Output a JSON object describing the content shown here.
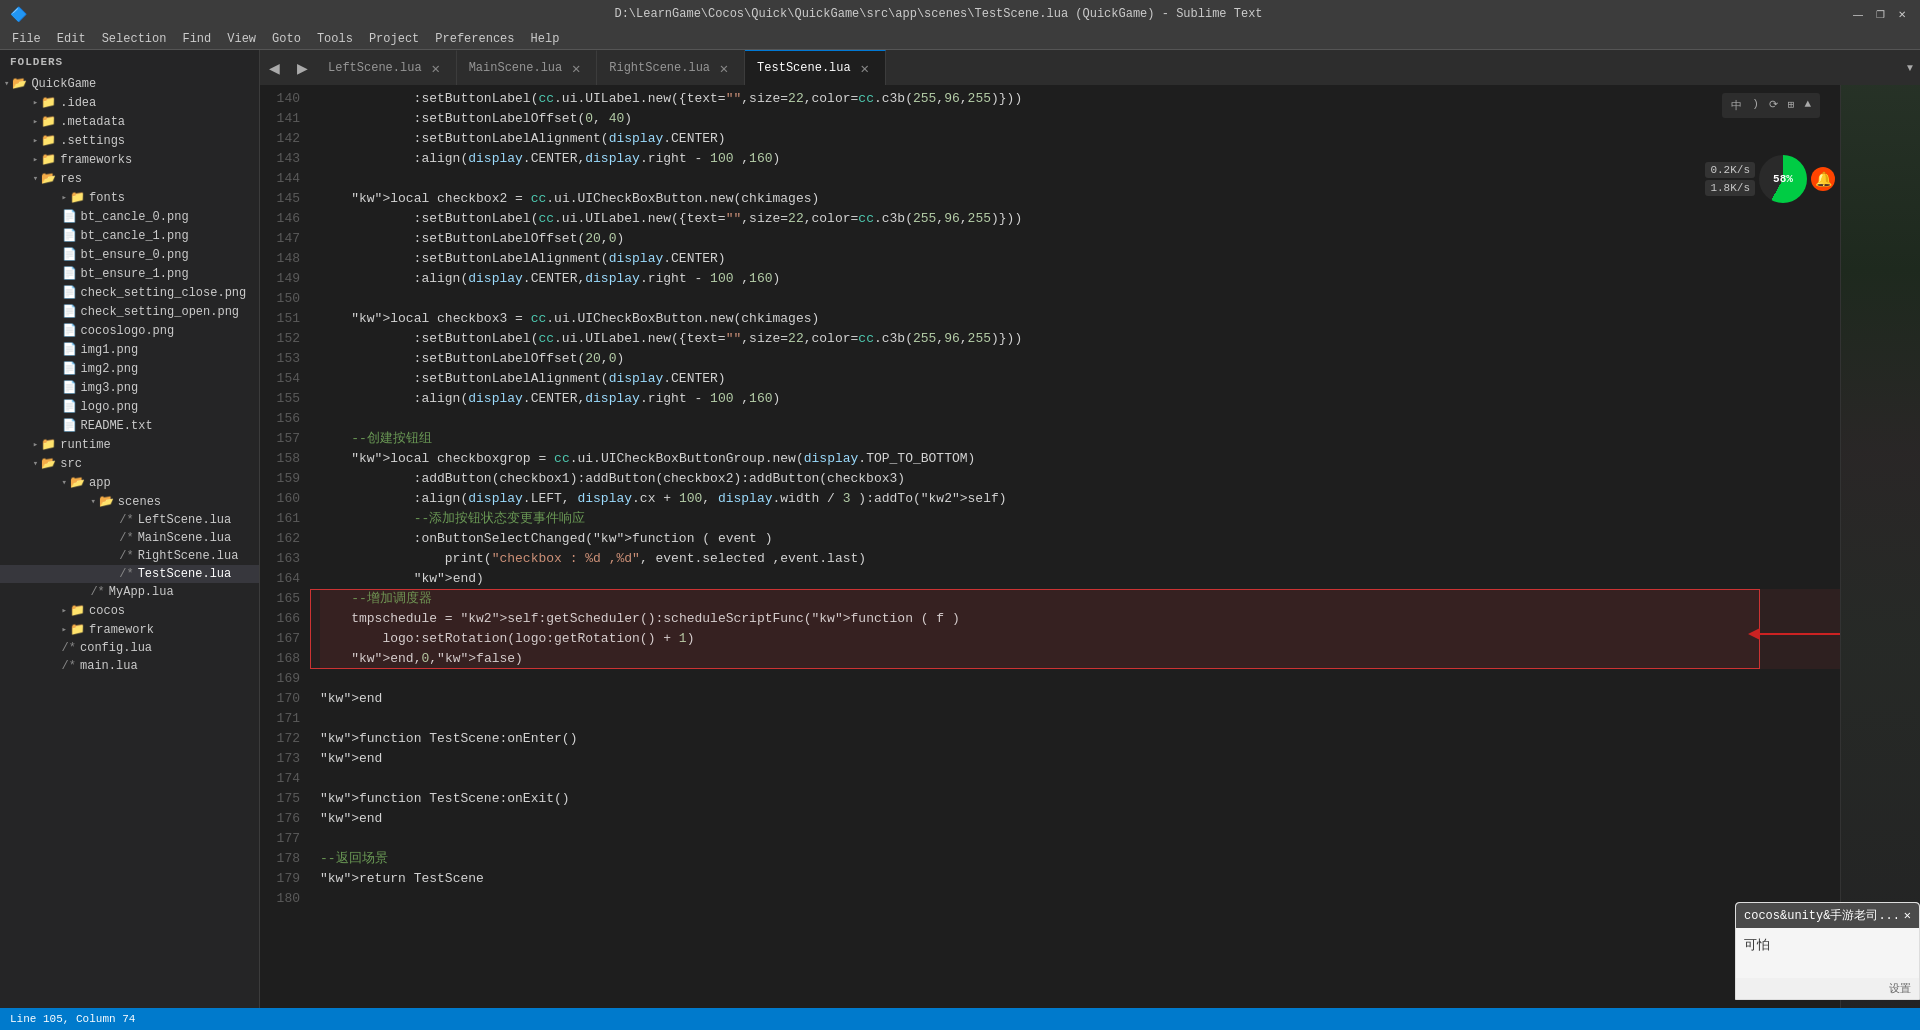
{
  "titleBar": {
    "title": "D:\\LearnGame\\Cocos\\Quick\\QuickGame\\src\\app\\scenes\\TestScene.lua (QuickGame) - Sublime Text",
    "minimize": "—",
    "maximize": "❐",
    "close": "✕"
  },
  "menuBar": {
    "items": [
      "File",
      "Edit",
      "Selection",
      "Find",
      "View",
      "Goto",
      "Tools",
      "Project",
      "Preferences",
      "Help"
    ]
  },
  "sidebar": {
    "header": "FOLDERS",
    "tree": [
      {
        "level": 0,
        "type": "folder",
        "open": true,
        "label": "QuickGame"
      },
      {
        "level": 1,
        "type": "folder",
        "open": false,
        "label": ".idea"
      },
      {
        "level": 1,
        "type": "folder",
        "open": false,
        "label": ".metadata"
      },
      {
        "level": 1,
        "type": "folder",
        "open": false,
        "label": ".settings"
      },
      {
        "level": 1,
        "type": "folder",
        "open": false,
        "label": "frameworks"
      },
      {
        "level": 1,
        "type": "folder",
        "open": true,
        "label": "res"
      },
      {
        "level": 2,
        "type": "folder",
        "open": false,
        "label": "fonts"
      },
      {
        "level": 2,
        "type": "file",
        "label": "bt_cancle_0.png"
      },
      {
        "level": 2,
        "type": "file",
        "label": "bt_cancle_1.png"
      },
      {
        "level": 2,
        "type": "file",
        "label": "bt_ensure_0.png"
      },
      {
        "level": 2,
        "type": "file",
        "label": "bt_ensure_1.png"
      },
      {
        "level": 2,
        "type": "file",
        "label": "check_setting_close.png"
      },
      {
        "level": 2,
        "type": "file",
        "label": "check_setting_open.png"
      },
      {
        "level": 2,
        "type": "file",
        "label": "cocoslogo.png"
      },
      {
        "level": 2,
        "type": "file",
        "label": "img1.png"
      },
      {
        "level": 2,
        "type": "file",
        "label": "img2.png"
      },
      {
        "level": 2,
        "type": "file",
        "label": "img3.png"
      },
      {
        "level": 2,
        "type": "file",
        "label": "logo.png"
      },
      {
        "level": 2,
        "type": "file",
        "label": "README.txt"
      },
      {
        "level": 1,
        "type": "folder",
        "open": false,
        "label": "runtime"
      },
      {
        "level": 1,
        "type": "folder",
        "open": true,
        "label": "src"
      },
      {
        "level": 2,
        "type": "folder",
        "open": true,
        "label": "app"
      },
      {
        "level": 3,
        "type": "folder",
        "open": true,
        "label": "scenes"
      },
      {
        "level": 4,
        "type": "lua",
        "label": "LeftScene.lua"
      },
      {
        "level": 4,
        "type": "lua",
        "label": "MainScene.lua"
      },
      {
        "level": 4,
        "type": "lua",
        "label": "RightScene.lua"
      },
      {
        "level": 4,
        "type": "lua",
        "label": "TestScene.lua",
        "active": true
      },
      {
        "level": 3,
        "type": "lua",
        "label": "MyApp.lua"
      },
      {
        "level": 2,
        "type": "folder",
        "open": false,
        "label": "cocos"
      },
      {
        "level": 2,
        "type": "folder",
        "open": false,
        "label": "framework"
      },
      {
        "level": 2,
        "type": "lua",
        "label": "config.lua"
      },
      {
        "level": 2,
        "type": "lua",
        "label": "main.lua"
      }
    ]
  },
  "tabs": [
    {
      "label": "LeftScene.lua",
      "active": false
    },
    {
      "label": "MainScene.lua",
      "active": false
    },
    {
      "label": "RightScene.lua",
      "active": false
    },
    {
      "label": "TestScene.lua",
      "active": true
    }
  ],
  "codeLines": [
    {
      "num": 140,
      "text": "            :setButtonLabel(cc.ui.UILabel.new({text=\"\",size=22,color=cc.c3b(255,96,255)}))"
    },
    {
      "num": 141,
      "text": "            :setButtonLabelOffset(0, 40)"
    },
    {
      "num": 142,
      "text": "            :setButtonLabelAlignment(display.CENTER)"
    },
    {
      "num": 143,
      "text": "            :align(display.CENTER,display.right - 100 ,160)"
    },
    {
      "num": 144,
      "text": ""
    },
    {
      "num": 145,
      "text": "    local checkbox2 = cc.ui.UICheckBoxButton.new(chkimages)"
    },
    {
      "num": 146,
      "text": "            :setButtonLabel(cc.ui.UILabel.new({text=\"\",size=22,color=cc.c3b(255,96,255)}))"
    },
    {
      "num": 147,
      "text": "            :setButtonLabelOffset(20,0)"
    },
    {
      "num": 148,
      "text": "            :setButtonLabelAlignment(display.CENTER)"
    },
    {
      "num": 149,
      "text": "            :align(display.CENTER,display.right - 100 ,160)"
    },
    {
      "num": 150,
      "text": ""
    },
    {
      "num": 151,
      "text": "    local checkbox3 = cc.ui.UICheckBoxButton.new(chkimages)"
    },
    {
      "num": 152,
      "text": "            :setButtonLabel(cc.ui.UILabel.new({text=\"\",size=22,color=cc.c3b(255,96,255)}))"
    },
    {
      "num": 153,
      "text": "            :setButtonLabelOffset(20,0)"
    },
    {
      "num": 154,
      "text": "            :setButtonLabelAlignment(display.CENTER)"
    },
    {
      "num": 155,
      "text": "            :align(display.CENTER,display.right - 100 ,160)"
    },
    {
      "num": 156,
      "text": ""
    },
    {
      "num": 157,
      "text": "    --创建按钮组"
    },
    {
      "num": 158,
      "text": "    local checkboxgrop = cc.ui.UICheckBoxButtonGroup.new(display.TOP_TO_BOTTOM)"
    },
    {
      "num": 159,
      "text": "            :addButton(checkbox1):addButton(checkbox2):addButton(checkbox3)"
    },
    {
      "num": 160,
      "text": "            :align(display.LEFT, display.cx + 100, display.width / 3 ):addTo(self)"
    },
    {
      "num": 161,
      "text": "            --添加按钮状态变更事件响应"
    },
    {
      "num": 162,
      "text": "            :onButtonSelectChanged(function ( event )"
    },
    {
      "num": 163,
      "text": "                print(\"checkbox : %d ,%d\", event.selected ,event.last)"
    },
    {
      "num": 164,
      "text": "            end)"
    },
    {
      "num": 165,
      "text": "    --增加调度器",
      "highlighted": true
    },
    {
      "num": 166,
      "text": "    tmpschedule = self:getScheduler():scheduleScriptFunc(function ( f )",
      "highlighted": true
    },
    {
      "num": 167,
      "text": "        logo:setRotation(logo:getRotation() + 1)",
      "highlighted": true
    },
    {
      "num": 168,
      "text": "    end,0,false)",
      "highlighted": true
    },
    {
      "num": 169,
      "text": ""
    },
    {
      "num": 170,
      "text": "end"
    },
    {
      "num": 171,
      "text": ""
    },
    {
      "num": 172,
      "text": "function TestScene:onEnter()"
    },
    {
      "num": 173,
      "text": "end"
    },
    {
      "num": 174,
      "text": ""
    },
    {
      "num": 175,
      "text": "function TestScene:onExit()"
    },
    {
      "num": 176,
      "text": "end"
    },
    {
      "num": 177,
      "text": ""
    },
    {
      "num": 178,
      "text": "--返回场景"
    },
    {
      "num": 179,
      "text": "return TestScene"
    },
    {
      "num": 180,
      "text": ""
    }
  ],
  "statusBar": {
    "position": "Line 105, Column 74"
  },
  "networkIndicator": {
    "download": "0.2K/s",
    "upload": "1.8K/s",
    "percent": "58%"
  },
  "chat": {
    "header": "cocos&unity&手游老司...",
    "message": "可怕",
    "footer": "设置"
  },
  "toolbarIcons": [
    "中",
    ")",
    "⟳",
    "⊞",
    "▲"
  ]
}
